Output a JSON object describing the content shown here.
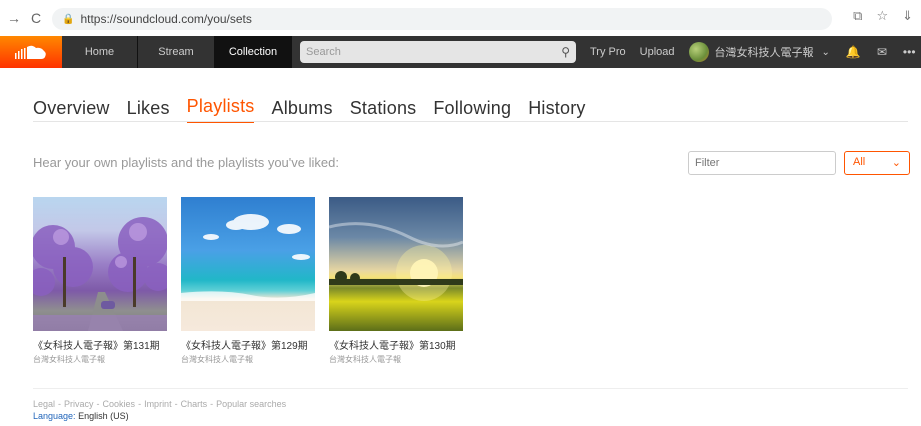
{
  "browser": {
    "url": "https://soundcloud.com/you/sets",
    "back_glyph": "→",
    "reload_glyph": "C",
    "lock_glyph": "🔒",
    "translate_glyph": "⧉",
    "star_glyph": "☆",
    "menu_glyph": "⇓"
  },
  "header": {
    "nav": [
      "Home",
      "Stream",
      "Collection"
    ],
    "active_nav": "Collection",
    "search_placeholder": "Search",
    "search_glyph": "⚲",
    "try_pro": "Try Pro",
    "upload": "Upload",
    "user_name": "台灣女科技人電子報",
    "chevron_glyph": "⌄",
    "bell_glyph": "🔔",
    "mail_glyph": "✉",
    "more_glyph": "•••"
  },
  "tabs": [
    "Overview",
    "Likes",
    "Playlists",
    "Albums",
    "Stations",
    "Following",
    "History"
  ],
  "active_tab": "Playlists",
  "intro": "Hear your own playlists and the playlists you've liked:",
  "filter": {
    "placeholder": "Filter",
    "selected": "All",
    "chevron_glyph": "⌄"
  },
  "playlists": [
    {
      "title": "《女科技人電子報》第131期",
      "user": "台灣女科技人電子報"
    },
    {
      "title": "《女科技人電子報》第129期",
      "user": "台灣女科技人電子報"
    },
    {
      "title": "《女科技人電子報》第130期",
      "user": "台灣女科技人電子報"
    }
  ],
  "footer": {
    "links": [
      "Legal",
      "-",
      "Privacy",
      "-",
      "Cookies",
      "-",
      "Imprint",
      "-",
      "Charts",
      "-",
      "Popular searches"
    ],
    "language_label": "Language:",
    "language_value": "English (US)"
  },
  "colors": {
    "accent": "#ff5500",
    "header_bg": "#333333"
  }
}
